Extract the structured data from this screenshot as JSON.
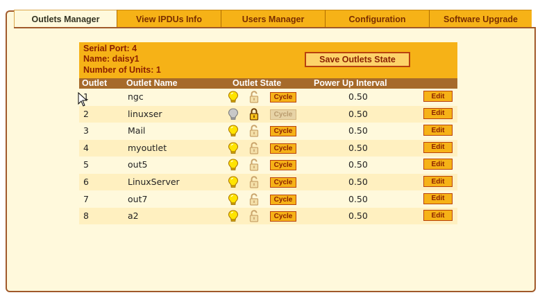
{
  "tabs": [
    {
      "label": "Outlets Manager",
      "active": true
    },
    {
      "label": "View IPDUs Info",
      "active": false
    },
    {
      "label": "Users Manager",
      "active": false
    },
    {
      "label": "Configuration",
      "active": false
    },
    {
      "label": "Software Upgrade",
      "active": false
    }
  ],
  "header": {
    "serial_port": "Serial Port: 4",
    "name": "Name: daisy1",
    "units": "Number of Units: 1",
    "save_button": "Save Outlets State"
  },
  "columns": {
    "outlet": "Outlet",
    "name": "Outlet Name",
    "state": "Outlet State",
    "interval": "Power Up Interval"
  },
  "rows": [
    {
      "outlet": "1",
      "name": "ngc",
      "on": true,
      "locked": false,
      "cycle": "Cycle",
      "cycle_enabled": true,
      "interval": "0.50",
      "edit": "Edit"
    },
    {
      "outlet": "2",
      "name": "linuxser",
      "on": false,
      "locked": true,
      "cycle": "Cycle",
      "cycle_enabled": false,
      "interval": "0.50",
      "edit": "Edit"
    },
    {
      "outlet": "3",
      "name": "Mail",
      "on": true,
      "locked": false,
      "cycle": "Cycle",
      "cycle_enabled": true,
      "interval": "0.50",
      "edit": "Edit"
    },
    {
      "outlet": "4",
      "name": "myoutlet",
      "on": true,
      "locked": false,
      "cycle": "Cycle",
      "cycle_enabled": true,
      "interval": "0.50",
      "edit": "Edit"
    },
    {
      "outlet": "5",
      "name": "out5",
      "on": true,
      "locked": false,
      "cycle": "Cycle",
      "cycle_enabled": true,
      "interval": "0.50",
      "edit": "Edit"
    },
    {
      "outlet": "6",
      "name": "LinuxServer",
      "on": true,
      "locked": false,
      "cycle": "Cycle",
      "cycle_enabled": true,
      "interval": "0.50",
      "edit": "Edit"
    },
    {
      "outlet": "7",
      "name": "out7",
      "on": true,
      "locked": false,
      "cycle": "Cycle",
      "cycle_enabled": true,
      "interval": "0.50",
      "edit": "Edit"
    },
    {
      "outlet": "8",
      "name": "a2",
      "on": true,
      "locked": false,
      "cycle": "Cycle",
      "cycle_enabled": true,
      "interval": "0.50",
      "edit": "Edit"
    }
  ],
  "icons": {
    "bulb_on": "light-bulb-on-icon",
    "bulb_off": "light-bulb-off-icon",
    "lock_open": "unlocked-padlock-icon",
    "lock_closed": "locked-padlock-icon"
  },
  "colors": {
    "accent": "#f6b217",
    "panel_bg": "#fff9dc",
    "header_text": "#8a1f00",
    "column_bar": "#a66a2a",
    "border": "#a0592a"
  }
}
